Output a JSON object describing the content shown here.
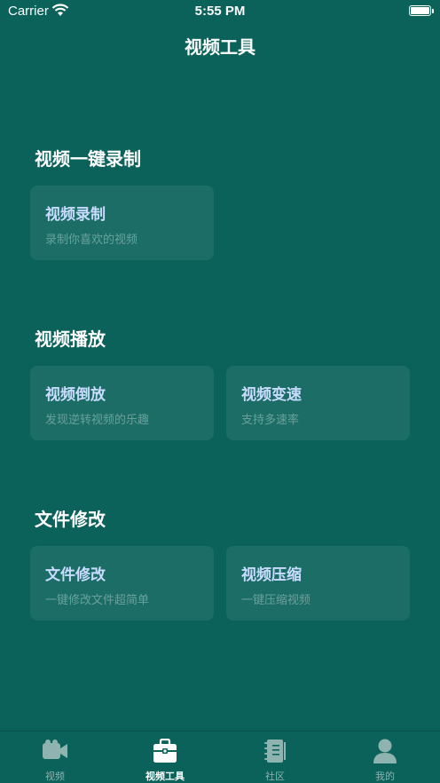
{
  "status_bar": {
    "carrier": "Carrier",
    "time": "5:55 PM"
  },
  "nav": {
    "title": "视频工具"
  },
  "sections": [
    {
      "title": "视频一键录制",
      "cards": [
        {
          "title": "视频录制",
          "subtitle": "录制你喜欢的视频"
        }
      ]
    },
    {
      "title": "视频播放",
      "cards": [
        {
          "title": "视频倒放",
          "subtitle": "发现逆转视频的乐趣"
        },
        {
          "title": "视频变速",
          "subtitle": "支持多速率"
        }
      ]
    },
    {
      "title": "文件修改",
      "cards": [
        {
          "title": "文件修改",
          "subtitle": "一键修改文件超简单"
        },
        {
          "title": "视频压缩",
          "subtitle": "一键压缩视频"
        }
      ]
    }
  ],
  "tab_bar": {
    "tabs": [
      {
        "label": "视频",
        "icon": "video-camera-icon",
        "active": false
      },
      {
        "label": "视频工具",
        "icon": "toolbox-icon",
        "active": true
      },
      {
        "label": "社区",
        "icon": "notebook-icon",
        "active": false
      },
      {
        "label": "我的",
        "icon": "person-icon",
        "active": false
      }
    ]
  },
  "colors": {
    "background": "#0a625b",
    "card_title": "#c9dcff",
    "tab_inactive": "#8fb3af"
  }
}
